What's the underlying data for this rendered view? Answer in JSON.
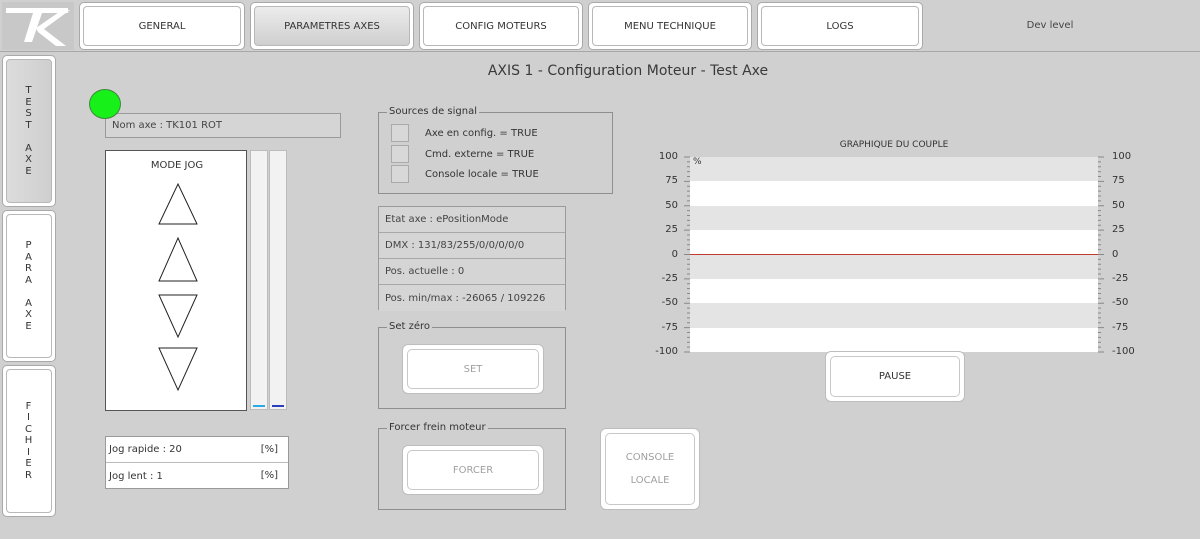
{
  "header": {
    "logo_text": "TK",
    "tabs": [
      {
        "label": "GENERAL"
      },
      {
        "label": "PARAMETRES AXES"
      },
      {
        "label": "CONFIG MOTEURS"
      },
      {
        "label": "MENU TECHNIQUE"
      },
      {
        "label": "LOGS"
      }
    ],
    "active_tab": "PARAMETRES AXES",
    "dev_level": "Dev level"
  },
  "sidebar": {
    "items": [
      {
        "label": "T\nE\nS\nT\n\nA\nX\nE"
      },
      {
        "label": "P\nA\nR\nA\n\nA\nX\nE"
      },
      {
        "label": "F\nI\nC\nH\nI\nE\nR"
      }
    ]
  },
  "page": {
    "title": "AXIS 1 - Configuration Moteur - Test Axe"
  },
  "axis": {
    "name": "Nom axe : TK101 ROT",
    "status_color": "#18f01a"
  },
  "jog": {
    "label": "MODE JOG",
    "rapide": "Jog rapide : 20",
    "lent": "Jog lent : 1",
    "unit": "[%]"
  },
  "sources": {
    "legend": "Sources de signal",
    "items": [
      "Axe en config. = TRUE",
      "Cmd. externe = TRUE",
      "Console locale = TRUE"
    ]
  },
  "etat": {
    "rows": [
      "Etat axe : ePositionMode",
      "DMX : 131/83/255/0/0/0/0/0",
      "Pos. actuelle : 0",
      "Pos. min/max : -26065 / 109226"
    ]
  },
  "set_zero": {
    "legend": "Set zéro",
    "button": "SET"
  },
  "frein": {
    "legend": "Forcer frein moteur",
    "button": "FORCER"
  },
  "console": {
    "line1": "CONSOLE",
    "line2": "LOCALE"
  },
  "chart": {
    "unit": "%",
    "pause": "PAUSE"
  },
  "chart_data": {
    "type": "line",
    "title": "GRAPHIQUE DU COUPLE",
    "ylim": [
      -100,
      100
    ],
    "yticks": [
      100,
      75,
      50,
      25,
      0,
      -25,
      -50,
      -75,
      -100
    ],
    "series": [
      {
        "values": [
          0,
          0,
          0,
          0,
          0,
          0,
          0,
          0,
          0,
          0,
          0,
          0,
          0,
          0,
          0,
          0,
          0,
          0,
          0,
          0,
          0
        ],
        "color": "#c0392b"
      }
    ],
    "grid": "horizontal-stripes"
  }
}
